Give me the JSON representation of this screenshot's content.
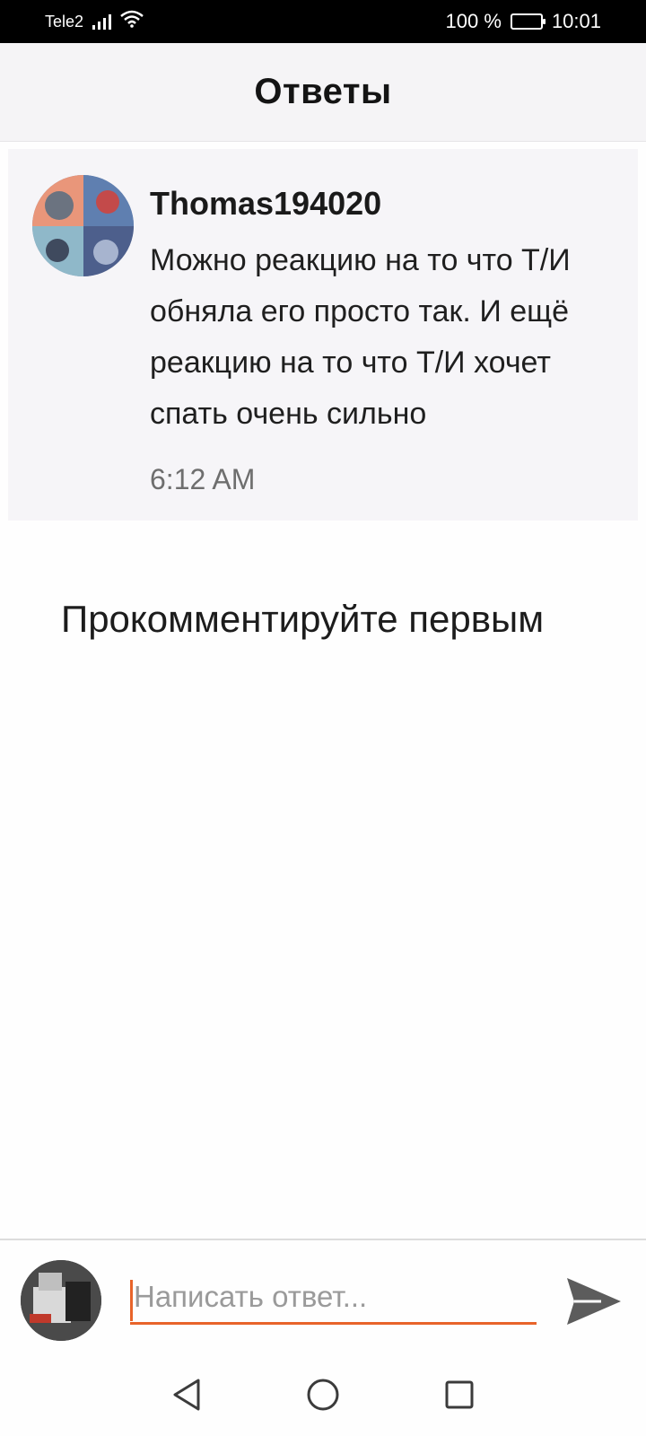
{
  "status_bar": {
    "carrier": "Tele2",
    "battery_text": "100 %",
    "battery_level": 1.0,
    "time": "10:01"
  },
  "header": {
    "title": "Ответы"
  },
  "reply": {
    "username": "Thomas194020",
    "text": "Можно реакцию на то что Т/И обняла его просто так. И ещё реакцию на то что Т/И хочет спать очень сильно",
    "time": "6:12 AM"
  },
  "empty_state": {
    "text": "Прокомментируйте первым"
  },
  "composer": {
    "placeholder": "Написать ответ...",
    "value": "",
    "accent_color": "#e8642a"
  },
  "nav": {
    "back_icon": "back-triangle-icon",
    "home_icon": "home-circle-icon",
    "recents_icon": "recents-square-icon"
  }
}
